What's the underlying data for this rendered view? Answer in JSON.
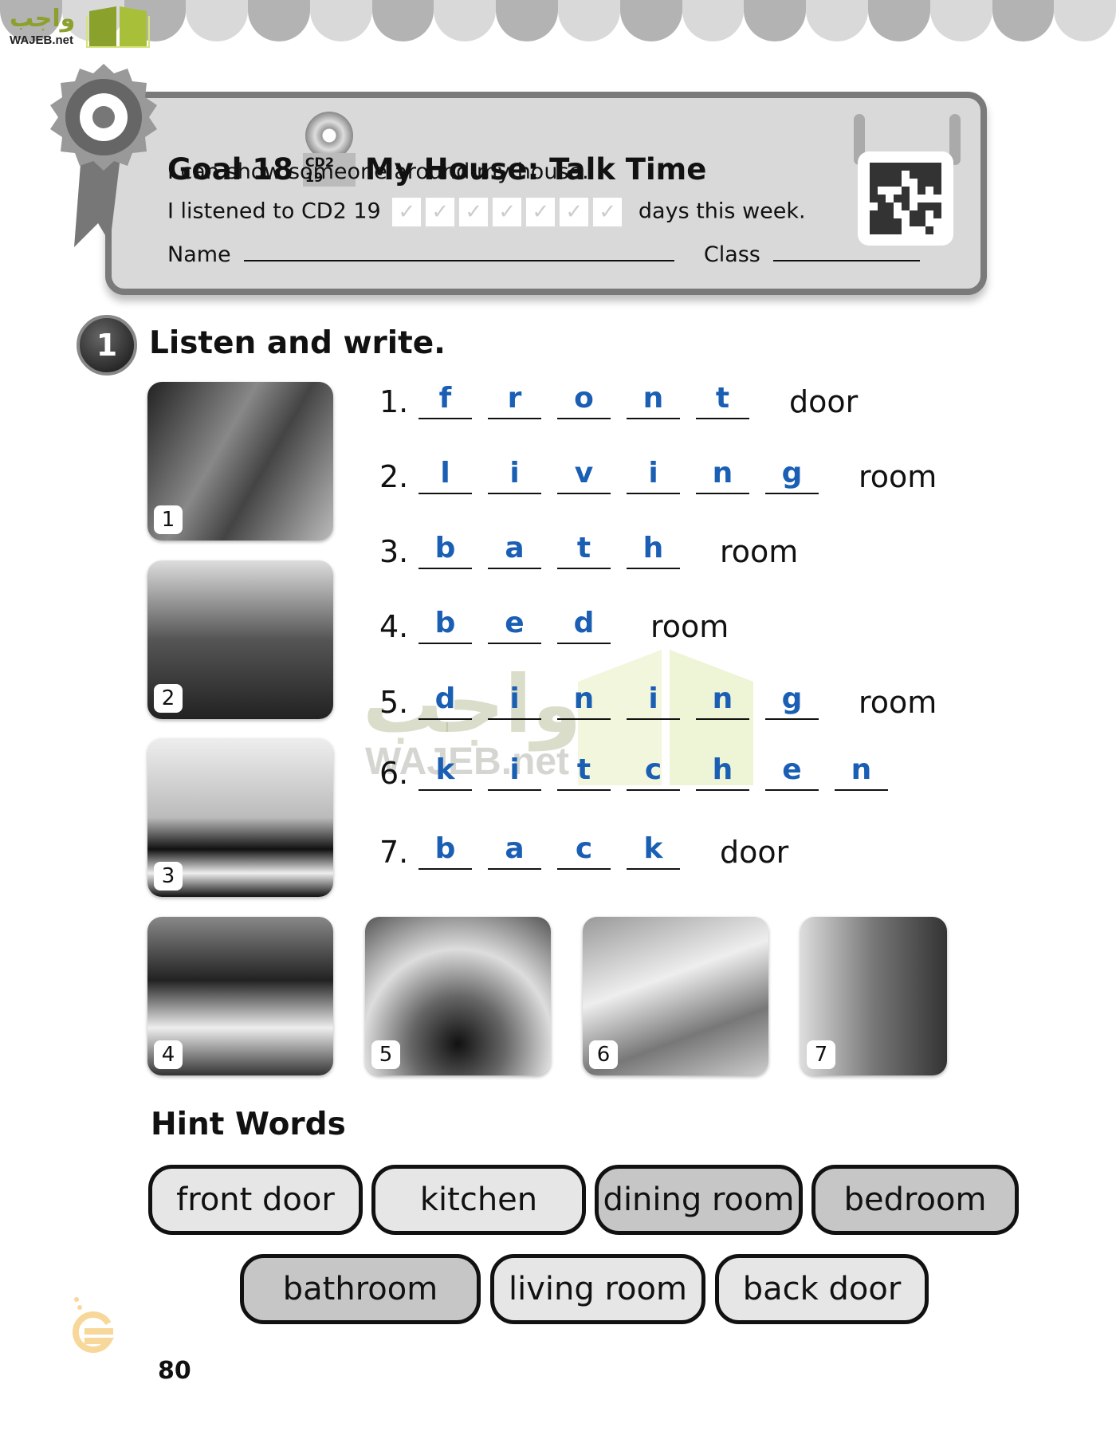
{
  "logo": {
    "arabic": "واجب",
    "latin": "WAJEB.net"
  },
  "colors": {
    "answer": "#1a5fb4",
    "pill_light": "#e6e6e6",
    "pill_dark": "#c6c6c6",
    "box": "#d9d9d9",
    "border": "#7a7a7a"
  },
  "goal": {
    "title": "Goal 18",
    "cd_label": "CD2 19",
    "subtitle": "My House: Talk Time",
    "objective": "I can show someone around my house.",
    "listened_prefix": "I listened to CD2 19",
    "listened_suffix": "days this week.",
    "day_boxes": 7,
    "name_label": "Name",
    "class_label": "Class"
  },
  "exercise": {
    "number": "1",
    "title": "Listen and write.",
    "photos": [
      "1",
      "2",
      "3",
      "4",
      "5",
      "6",
      "7"
    ],
    "rows": [
      {
        "num": "1.",
        "letters": [
          "f",
          "r",
          "o",
          "n",
          "t"
        ],
        "word": "door"
      },
      {
        "num": "2.",
        "letters": [
          "l",
          "i",
          "v",
          "i",
          "n",
          "g"
        ],
        "word": "room"
      },
      {
        "num": "3.",
        "letters": [
          "b",
          "a",
          "t",
          "h"
        ],
        "word": "room"
      },
      {
        "num": "4.",
        "letters": [
          "b",
          "e",
          "d"
        ],
        "word": "room"
      },
      {
        "num": "5.",
        "letters": [
          "d",
          "i",
          "n",
          "i",
          "n",
          "g"
        ],
        "word": "room"
      },
      {
        "num": "6.",
        "letters": [
          "k",
          "i",
          "t",
          "c",
          "h",
          "e",
          "n"
        ],
        "word": ""
      },
      {
        "num": "7.",
        "letters": [
          "b",
          "a",
          "c",
          "k"
        ],
        "word": "door"
      }
    ]
  },
  "hints": {
    "title": "Hint Words",
    "words": [
      {
        "label": "front door",
        "shade": "light"
      },
      {
        "label": "kitchen",
        "shade": "light"
      },
      {
        "label": "dining room",
        "shade": "dark"
      },
      {
        "label": "bedroom",
        "shade": "dark"
      },
      {
        "label": "bathroom",
        "shade": "dark"
      },
      {
        "label": "living room",
        "shade": "light"
      },
      {
        "label": "back door",
        "shade": "light"
      }
    ]
  },
  "page_number": "80"
}
